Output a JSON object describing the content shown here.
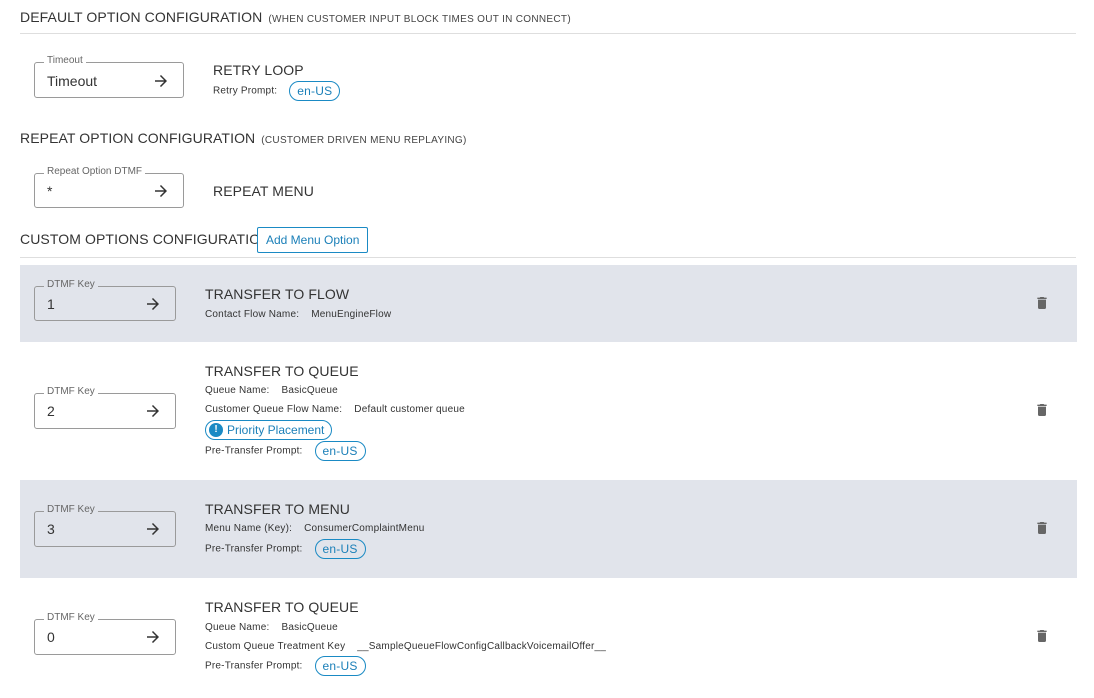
{
  "default_section": {
    "title": "DEFAULT OPTION CONFIGURATION",
    "subtitle": "(WHEN CUSTOMER INPUT BLOCK TIMES OUT IN CONNECT)",
    "field_label": "Timeout",
    "field_value": "Timeout",
    "action_title": "RETRY LOOP",
    "prompt_label": "Retry Prompt:",
    "prompt_chip": "en-US"
  },
  "repeat_section": {
    "title": "REPEAT OPTION CONFIGURATION",
    "subtitle": "(CUSTOMER DRIVEN MENU REPLAYING)",
    "field_label": "Repeat Option DTMF",
    "field_value": "*",
    "action_title": "REPEAT MENU"
  },
  "custom_section": {
    "title": "CUSTOM OPTIONS CONFIGURATION",
    "add_button": "Add Menu Option"
  },
  "options": [
    {
      "key_label": "DTMF Key",
      "key": "1",
      "action": "TRANSFER TO FLOW",
      "details": [
        {
          "label": "Contact Flow Name:",
          "value": "MenuEngineFlow"
        }
      ]
    },
    {
      "key_label": "DTMF Key",
      "key": "2",
      "action": "TRANSFER TO QUEUE",
      "details": [
        {
          "label": "Queue Name:",
          "value": "BasicQueue"
        },
        {
          "label": "Customer Queue Flow Name:",
          "value": "Default customer queue"
        }
      ],
      "badge": "Priority Placement",
      "prompt_label": "Pre-Transfer Prompt:",
      "prompt_chip": "en-US"
    },
    {
      "key_label": "DTMF Key",
      "key": "3",
      "action": "TRANSFER TO MENU",
      "details": [
        {
          "label": "Menu Name (Key):",
          "value": "ConsumerComplaintMenu"
        }
      ],
      "prompt_label": "Pre-Transfer Prompt:",
      "prompt_chip": "en-US"
    },
    {
      "key_label": "DTMF Key",
      "key": "0",
      "action": "TRANSFER TO QUEUE",
      "details": [
        {
          "label": "Queue Name:",
          "value": "BasicQueue"
        },
        {
          "label": "Custom Queue Treatment Key",
          "value": "__SampleQueueFlowConfigCallbackVoicemailOffer__"
        }
      ],
      "prompt_label": "Pre-Transfer Prompt:",
      "prompt_chip": "en-US"
    }
  ],
  "icons": {
    "arrow": "arrow-right-icon",
    "delete": "trash-icon",
    "alert": "exclamation-icon"
  },
  "colors": {
    "accent": "#1a8ac4",
    "row_alt_bg": "#e1e4eb"
  }
}
